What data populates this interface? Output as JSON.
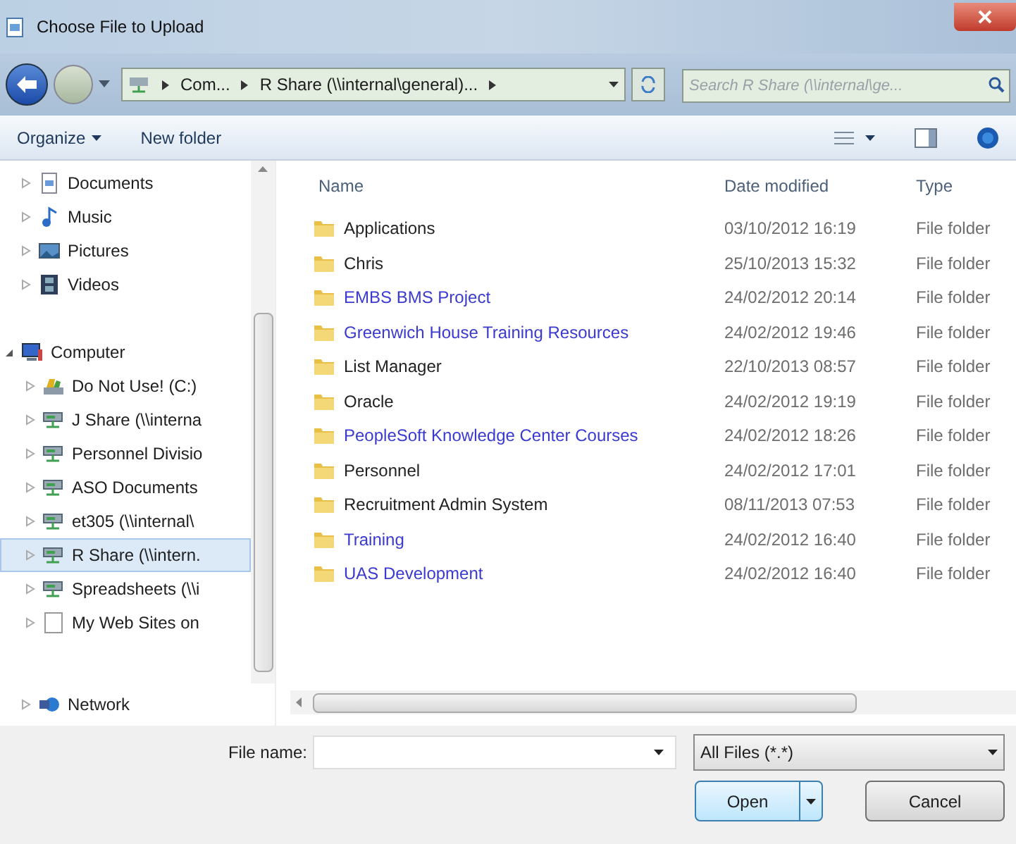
{
  "window": {
    "title": "Choose File to Upload"
  },
  "address_bar": {
    "crumbs": [
      "Com...",
      "R Share (\\\\internal\\general)..."
    ]
  },
  "search": {
    "placeholder": "Search R Share (\\\\internal\\ge..."
  },
  "toolbar": {
    "organize": "Organize",
    "new_folder": "New folder"
  },
  "nav": [
    {
      "label": "Documents",
      "kind": "library",
      "expanded": false,
      "selected": false
    },
    {
      "label": "Music",
      "kind": "music",
      "expanded": false,
      "selected": false
    },
    {
      "label": "Pictures",
      "kind": "pictures",
      "expanded": false,
      "selected": false
    },
    {
      "label": "Videos",
      "kind": "videos",
      "expanded": false,
      "selected": false
    },
    {
      "label": "Computer",
      "kind": "computer",
      "expanded": true,
      "selected": false,
      "children": [
        {
          "label": "Do Not Use! (C:)",
          "kind": "drive",
          "expanded": false,
          "selected": false
        },
        {
          "label": "J Share (\\\\interna",
          "kind": "share",
          "expanded": false,
          "selected": false
        },
        {
          "label": "Personnel Divisio",
          "kind": "share",
          "expanded": false,
          "selected": false
        },
        {
          "label": "ASO Documents",
          "kind": "share",
          "expanded": false,
          "selected": false
        },
        {
          "label": "et305 (\\\\internal\\",
          "kind": "share",
          "expanded": false,
          "selected": false
        },
        {
          "label": "R Share (\\\\intern.",
          "kind": "share",
          "expanded": false,
          "selected": true
        },
        {
          "label": "Spreadsheets (\\\\i",
          "kind": "share",
          "expanded": false,
          "selected": false
        },
        {
          "label": "My Web Sites on",
          "kind": "page",
          "expanded": false,
          "selected": false
        }
      ]
    },
    {
      "label": "Network",
      "kind": "network",
      "expanded": false,
      "selected": false
    }
  ],
  "table": {
    "columns": [
      "Name",
      "Date modified",
      "Type"
    ],
    "rows": [
      {
        "name": "Applications",
        "date": "03/10/2012 16:19",
        "type": "File folder",
        "color": "#222222"
      },
      {
        "name": "Chris",
        "date": "25/10/2013 15:32",
        "type": "File folder",
        "color": "#222222"
      },
      {
        "name": "EMBS BMS Project",
        "date": "24/02/2012 20:14",
        "type": "File folder",
        "color": "#3a3ad0"
      },
      {
        "name": "Greenwich House Training Resources",
        "date": "24/02/2012 19:46",
        "type": "File folder",
        "color": "#3a3ad0"
      },
      {
        "name": "List Manager",
        "date": "22/10/2013 08:57",
        "type": "File folder",
        "color": "#222222"
      },
      {
        "name": "Oracle",
        "date": "24/02/2012 19:19",
        "type": "File folder",
        "color": "#222222"
      },
      {
        "name": "PeopleSoft Knowledge Center Courses",
        "date": "24/02/2012 18:26",
        "type": "File folder",
        "color": "#3a3ad0"
      },
      {
        "name": "Personnel",
        "date": "24/02/2012 17:01",
        "type": "File folder",
        "color": "#222222"
      },
      {
        "name": "Recruitment Admin System",
        "date": "08/11/2013 07:53",
        "type": "File folder",
        "color": "#222222"
      },
      {
        "name": "Training",
        "date": "24/02/2012 16:40",
        "type": "File folder",
        "color": "#3a3ad0"
      },
      {
        "name": "UAS Development",
        "date": "24/02/2012 16:40",
        "type": "File folder",
        "color": "#3a3ad0"
      }
    ]
  },
  "file_name": {
    "label": "File name:"
  },
  "filter": {
    "value": "All Files (*.*)"
  },
  "buttons": {
    "open": "Open",
    "cancel": "Cancel"
  }
}
